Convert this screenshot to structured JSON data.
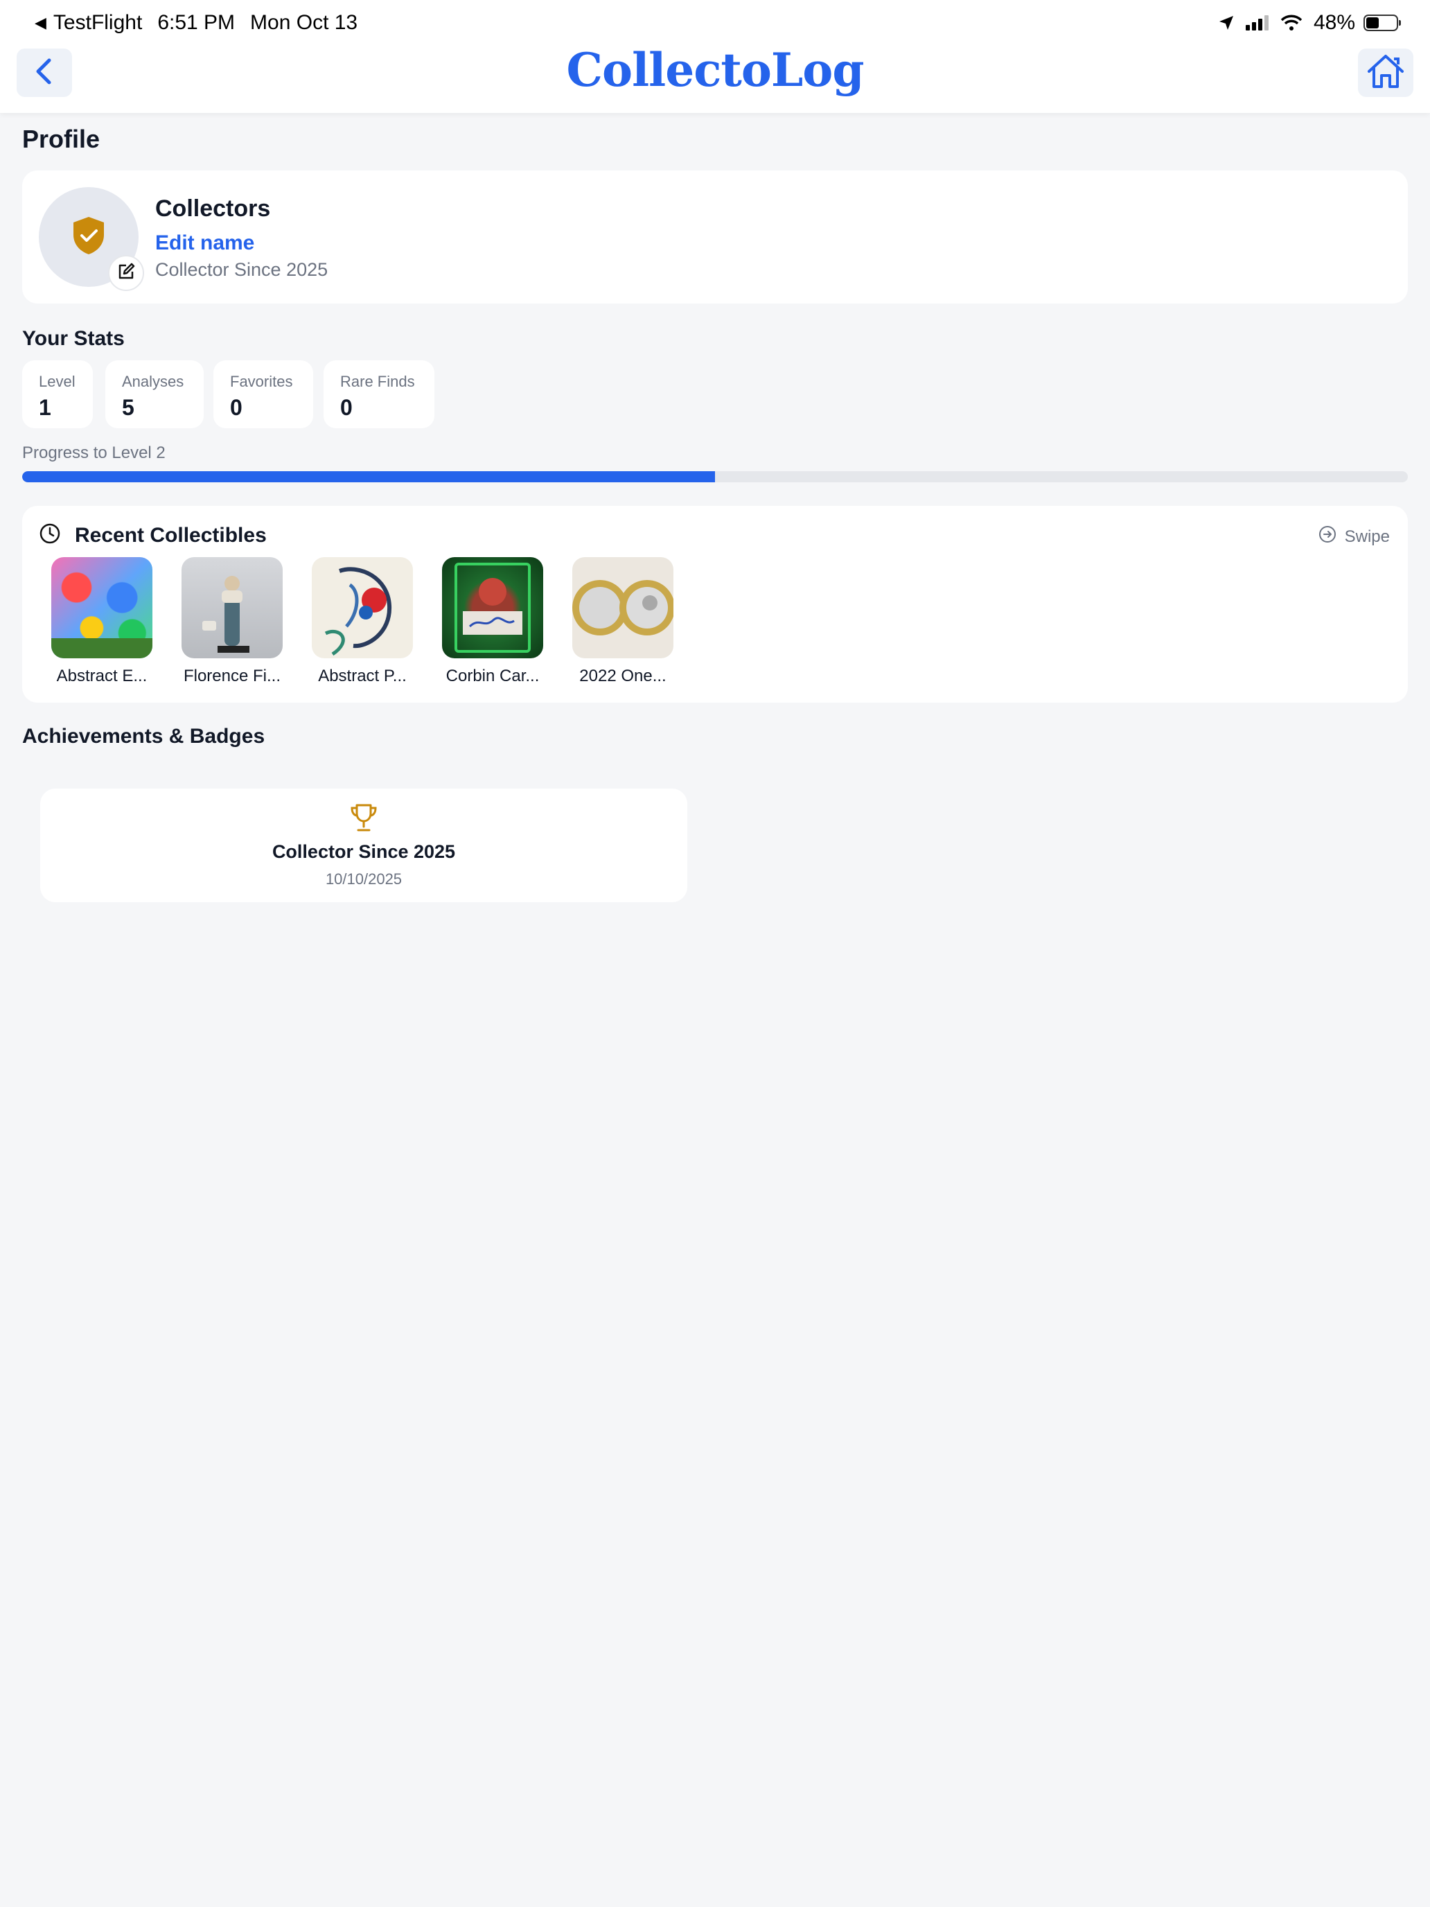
{
  "status_bar": {
    "back_app": "TestFlight",
    "time": "6:51 PM",
    "date": "Mon Oct 13",
    "battery": "48%"
  },
  "header": {
    "title": "CollectoLog"
  },
  "profile": {
    "section_title": "Profile",
    "name": "Collectors",
    "edit_name_label": "Edit name",
    "since": "Collector Since 2025"
  },
  "stats": {
    "section_title": "Your Stats",
    "items": [
      {
        "label": "Level",
        "value": "1"
      },
      {
        "label": "Analyses",
        "value": "5"
      },
      {
        "label": "Favorites",
        "value": "0"
      },
      {
        "label": "Rare Finds",
        "value": "0"
      }
    ],
    "progress_label": "Progress to Level 2",
    "progress_fraction": 0.5
  },
  "recent": {
    "title": "Recent Collectibles",
    "swipe_label": "Swipe",
    "items": [
      {
        "label": "Abstract E..."
      },
      {
        "label": "Florence Fi..."
      },
      {
        "label": "Abstract P..."
      },
      {
        "label": "Corbin Car..."
      },
      {
        "label": "2022 One..."
      }
    ]
  },
  "achievements": {
    "section_title": "Achievements & Badges",
    "badges": [
      {
        "name": "Collector Since 2025",
        "date": "10/10/2025"
      }
    ]
  },
  "colors": {
    "accent": "#2563eb",
    "badge_gold": "#c98a0c",
    "background": "#f5f6f8"
  },
  "icons": {
    "back": "chevron-left-icon",
    "home": "home-icon",
    "avatar": "shield-check-icon",
    "edit": "edit-icon",
    "recent": "clock-icon",
    "swipe": "arrow-right-circle-icon",
    "badge": "trophy-icon"
  }
}
